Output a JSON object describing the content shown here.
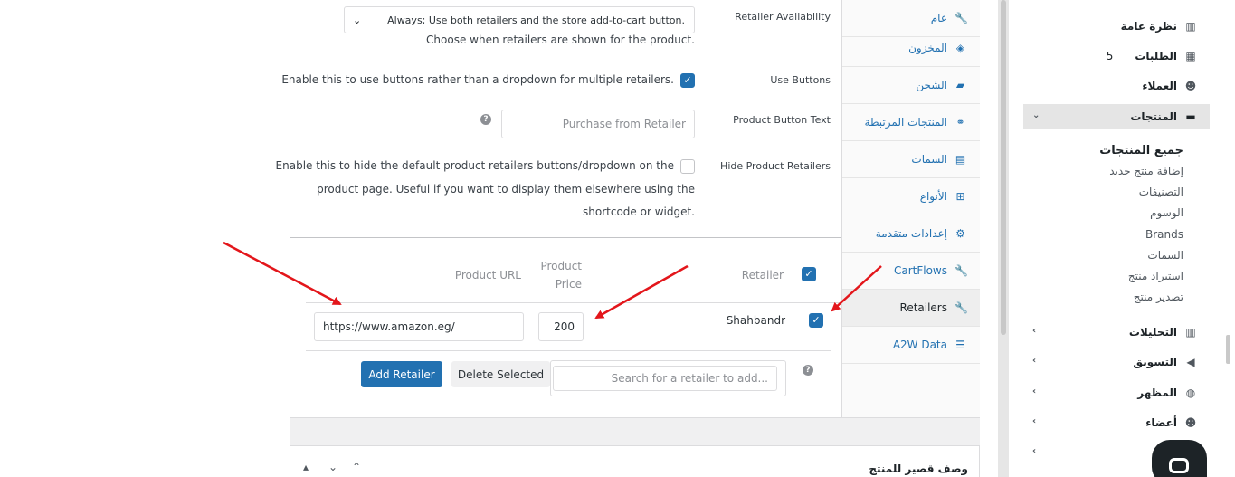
{
  "settings": {
    "availability_label": "Retailer Availability",
    "availability_value": "Always; Use both retailers and the store add-to-cart button.",
    "availability_desc": "Choose when retailers are shown for the product.",
    "use_buttons_label": "Use Buttons",
    "use_buttons_desc": "Enable this to use buttons rather than a dropdown for multiple retailers.",
    "button_text_label": "Product Button Text",
    "button_text_placeholder": "Purchase from Retailer",
    "hide_label": "Hide Product Retailers",
    "hide_desc_line1": "Enable this to hide the default product retailers buttons/dropdown on the",
    "hide_desc_line2": "product page. Useful if you want to display them elsewhere using the",
    "hide_desc_line3": "shortcode or widget."
  },
  "retailers_table": {
    "col_retailer": "Retailer",
    "col_price_line1": "Product",
    "col_price_line2": "Price",
    "col_url": "Product URL",
    "row": {
      "name": "Shahbandr",
      "price": "200",
      "url": "https://www.amazon.eg/"
    },
    "search_placeholder": "Search for a retailer to add...",
    "delete_label": "Delete Selected",
    "add_label": "Add Retailer"
  },
  "tabs": [
    {
      "label": "عام",
      "icon": "wrench-icon"
    },
    {
      "label": "المخزون",
      "icon": "tag-icon"
    },
    {
      "label": "الشحن",
      "icon": "truck-icon"
    },
    {
      "label": "المنتجات المرتبطة",
      "icon": "link-icon"
    },
    {
      "label": "السمات",
      "icon": "list-icon"
    },
    {
      "label": "الأنواع",
      "icon": "grid-icon"
    },
    {
      "label": "إعدادات متقدمة",
      "icon": "gear-icon"
    },
    {
      "label": "CartFlows",
      "icon": "wrench-icon"
    },
    {
      "label": "Retailers",
      "icon": "wrench-icon"
    },
    {
      "label": "A2W Data",
      "icon": "database-icon"
    }
  ],
  "short_description": {
    "title": "وصف قصير للمنتج"
  },
  "sidebar": {
    "overview": "نظرة عامة",
    "orders": "الطلبات",
    "orders_count": "5",
    "customers": "العملاء",
    "products": "المنتجات",
    "products_sub": [
      "جميع المنتجات",
      "إضافة منتج جديد",
      "التصنيفات",
      "الوسوم",
      "Brands",
      "السمات",
      "استيراد منتج",
      "تصدير منتج"
    ],
    "analytics": "التحليلات",
    "marketing": "التسويق",
    "appearance": "المظهر",
    "members": "أعضاء"
  },
  "colors": {
    "accent": "#2271b1",
    "annotation_arrow": "#e3161b"
  }
}
